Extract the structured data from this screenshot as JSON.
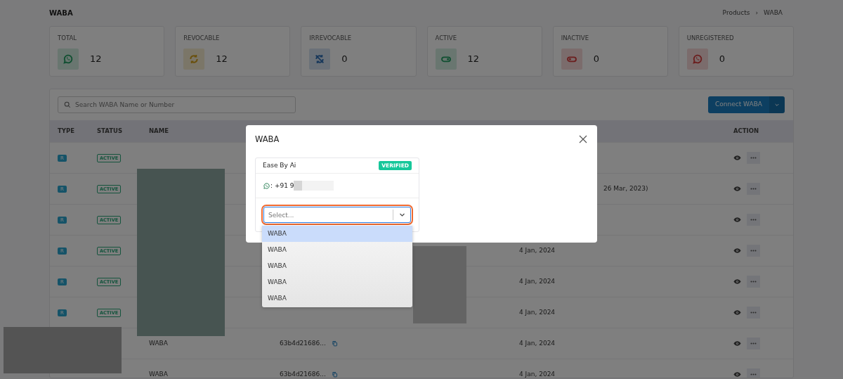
{
  "page": {
    "title": "WABA",
    "breadcrumb": [
      "Products",
      "WABA"
    ],
    "breadcrumb_separator": "›"
  },
  "stats": [
    {
      "label": "TOTAL",
      "value": "12",
      "kind": "whatsapp",
      "color": "#104f31"
    },
    {
      "label": "REVOCABLE",
      "value": "12",
      "kind": "sync",
      "color": "#6a500c"
    },
    {
      "label": "IRREVOCABLE",
      "value": "0",
      "kind": "sync-off",
      "color": "#18385b"
    },
    {
      "label": "ACTIVE",
      "value": "12",
      "kind": "toggle-on",
      "color": "#104f31"
    },
    {
      "label": "INACTIVE",
      "value": "0",
      "kind": "toggle-off",
      "color": "#6b1e1e"
    },
    {
      "label": "UNREGISTERED",
      "value": "0",
      "kind": "whatsapp",
      "color": "#6b1e1e"
    }
  ],
  "search": {
    "placeholder": "Search WABA Name or Number"
  },
  "connect_button": {
    "label": "Connect WABA"
  },
  "table": {
    "columns": [
      "TYPE",
      "STATUS",
      "NAME",
      "ACTION"
    ],
    "rows": [
      {
        "type": "R",
        "status": "ACTIVE"
      },
      {
        "type": "R",
        "status": "ACTIVE",
        "detail": "26 Mar, 2023)"
      },
      {
        "type": "R",
        "status": "ACTIVE"
      },
      {
        "type": "R",
        "status": "ACTIVE",
        "date": "4 Jan, 2024"
      },
      {
        "type": "R",
        "status": "ACTIVE",
        "date": "4 Jan, 2024"
      },
      {
        "type": "R",
        "status": "ACTIVE",
        "date": "4 Jan, 2024"
      },
      {
        "name": "WABA",
        "id": "63b4d21686...",
        "date": "4 Jan, 2024"
      },
      {
        "name": "WABA",
        "id": "63b4d21686...",
        "date": "4 Jan, 2024"
      }
    ]
  },
  "modal": {
    "title": "WABA",
    "account": {
      "name": "Ease By Ai",
      "badge": "VERIFIED",
      "phone": ": +91 9"
    },
    "select": {
      "placeholder": "Select...",
      "highlighted": true
    },
    "options": [
      {
        "label": "WABA",
        "selected": true
      },
      {
        "label": "WABA",
        "selected": false
      },
      {
        "label": "WABA",
        "selected": false
      },
      {
        "label": "WABA",
        "selected": false
      },
      {
        "label": "WABA",
        "selected": false
      }
    ]
  }
}
